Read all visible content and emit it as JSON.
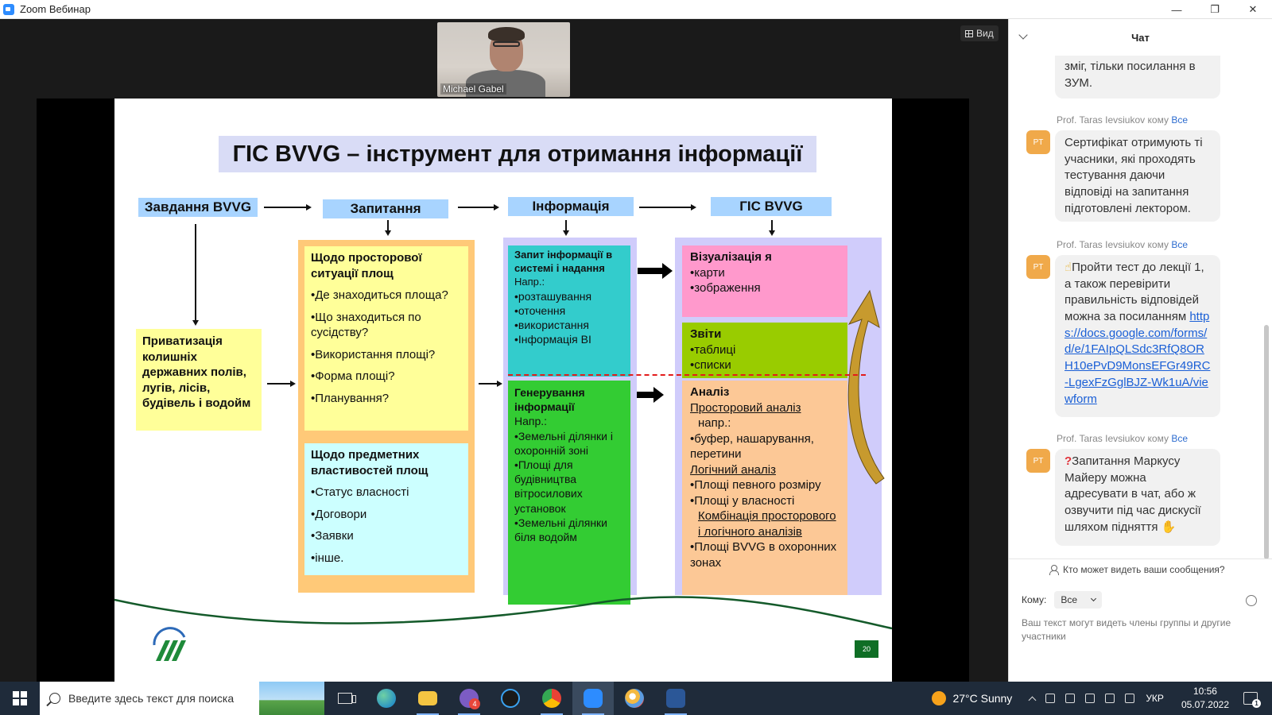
{
  "window": {
    "title": "Zoom Вебинар",
    "min": "—",
    "restore": "❐",
    "close": "✕"
  },
  "speaker": {
    "name": "Michael Gabel"
  },
  "view_button": {
    "label": "Вид"
  },
  "slide": {
    "title": "ГІС BVVG – інструмент для отримання інформації",
    "labels": [
      "Завдання BVVG",
      "Запитання",
      "Інформація",
      "ГІС BVVG"
    ],
    "privatization": "Приватизація колишніх державних полів, лугів, лісів, будівель і водойм",
    "questions_spatial": {
      "heading": "Щодо просторової ситуації площ",
      "items": [
        "Де знаходиться площа?",
        "Що знаходиться по сусідству?",
        "Використання площі?",
        "Форма площі?",
        "Планування?"
      ]
    },
    "questions_objects": {
      "heading": "Щодо предметних властивостей площ",
      "items": [
        "Статус власності",
        "Договори",
        "Заявки",
        "інше."
      ]
    },
    "info_query": {
      "heading": "Запит інформації в системі і надання",
      "example": "Напр.:",
      "items": [
        "розташування",
        "оточення",
        "використання",
        "Інформація ВІ"
      ]
    },
    "info_generate": {
      "heading": "Генерування інформації",
      "example": "Напр.:",
      "items": [
        "Земельні ділянки і охоронній зоні",
        "Площі для будівництва вітросилових установок",
        "Земельні ділянки біля водойм"
      ]
    },
    "gis_visual": {
      "heading": "Візуалізація я",
      "items": [
        "карти",
        "зображення"
      ]
    },
    "gis_reports": {
      "heading": "Звіти",
      "items": [
        "таблиці",
        "списки"
      ]
    },
    "gis_analysis": {
      "heading": "Аналіз",
      "spatial": "Просторовий аналіз",
      "example": "напр.:",
      "item1": "буфер, нашарування, перетини",
      "logical": "Логічний аналіз",
      "item2": "Площі певного розміру",
      "item3": "Площі у власності",
      "combo": "Комбінація просторового і логічного аналізів",
      "item4": "Площі BVVG в охоронних зонах"
    },
    "page_number": "20"
  },
  "chat": {
    "header": "Чат",
    "fragment": "зміг, тільки посилання в ЗУМ.",
    "messages": [
      {
        "sender": "Prof. Taras Ievsiukov",
        "to_word": "кому",
        "to": "Все",
        "avatar": "PT",
        "text": "Сертифікат отримують ті учасники, які проходять тестування даючи відповіді на запитання підготовлені лектором."
      },
      {
        "sender": "Prof. Taras Ievsiukov",
        "to_word": "кому",
        "to": "Все",
        "avatar": "PT",
        "text": "Пройти тест до лекції 1, а також перевірити правильність відповідей можна за посиланням",
        "link": "https://docs.google.com/forms/d/e/1FAIpQLSdc3RfQ8ORH10ePvD9MonsEFGr49RC-LgexFzGglBJZ-Wk1uA/viewform"
      },
      {
        "sender": "Prof. Taras Ievsiukov",
        "to_word": "кому",
        "to": "Все",
        "avatar": "PT",
        "text": "Запитання Маркусу Майеру можна адресувати в чат, або ж озвучити під час дискусії шляхом підняття"
      }
    ],
    "who_can_see": "Кто может видеть ваши сообщения?",
    "to_label": "Кому:",
    "to_value": "Все",
    "placeholder": "Ваш текст могут видеть члены группы и другие участники"
  },
  "taskbar": {
    "search_placeholder": "Введите здесь текст для поиска",
    "weather": "27°C  Sunny",
    "lang": "УКР",
    "time": "10:56",
    "date": "05.07.2022",
    "viber_badge": "4",
    "notif_badge": "1"
  },
  "colors": {
    "accent": "#2d8cff",
    "avatar": "#f0a94a",
    "link": "#1a5fd6",
    "taskbar": "#1f2b3a"
  }
}
